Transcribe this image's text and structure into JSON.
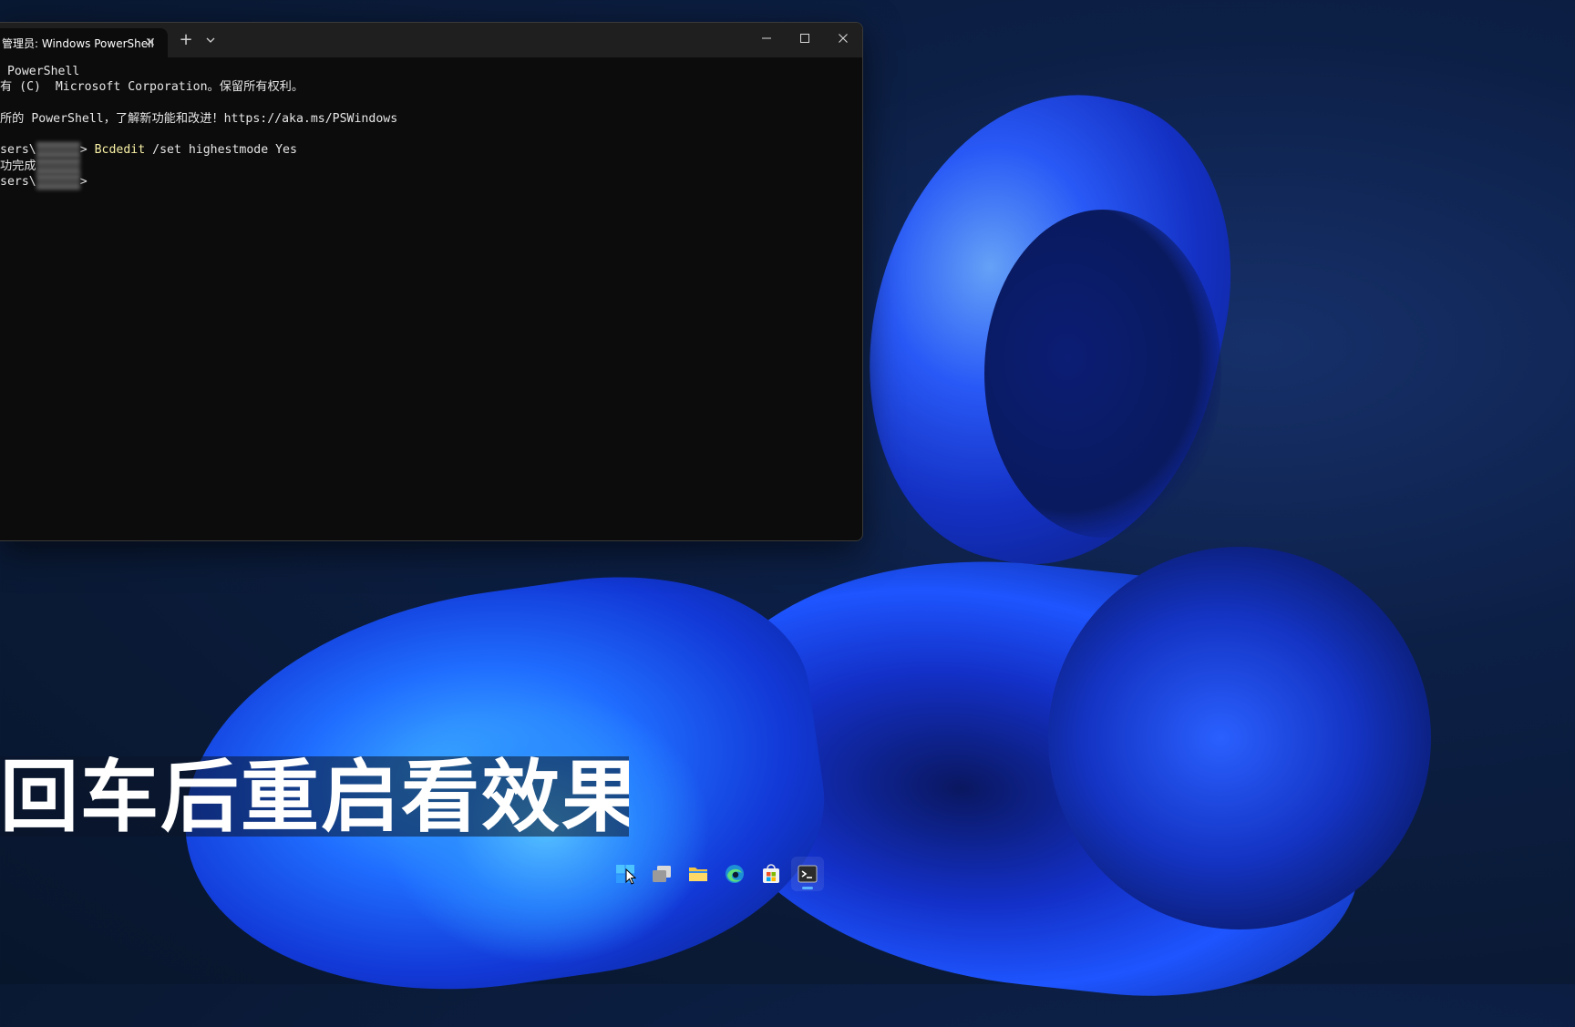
{
  "terminal": {
    "tab_title": "管理员: Windows PowerShell",
    "close_tab_symbol": "✕",
    "new_tab_symbol": "+",
    "window_min": "—",
    "window_max": "☐",
    "window_close": "✕",
    "lines": [
      " PowerShell",
      "有 (C)  Microsoft Corporation。保留所有权利。",
      "",
      "所的 PowerShell，了解新功能和改进！https://aka.ms/PSWindows",
      ""
    ],
    "prompt_prefix": "sers\\",
    "prompt_suffix": ">",
    "command_name": "Bcdedit",
    "command_args": " /set highestmode Yes",
    "result_text": "功完成"
  },
  "subtitle": "回车后重启看效果",
  "taskbar": {
    "items": [
      "start-icon",
      "task-view-icon",
      "file-explorer-icon",
      "edge-icon",
      "store-icon",
      "terminal-icon"
    ]
  },
  "colors": {
    "console_bg": "#0c0c0c",
    "command_yellow": "#f9f1a5",
    "wallpaper_blue": "#1e55ff"
  }
}
